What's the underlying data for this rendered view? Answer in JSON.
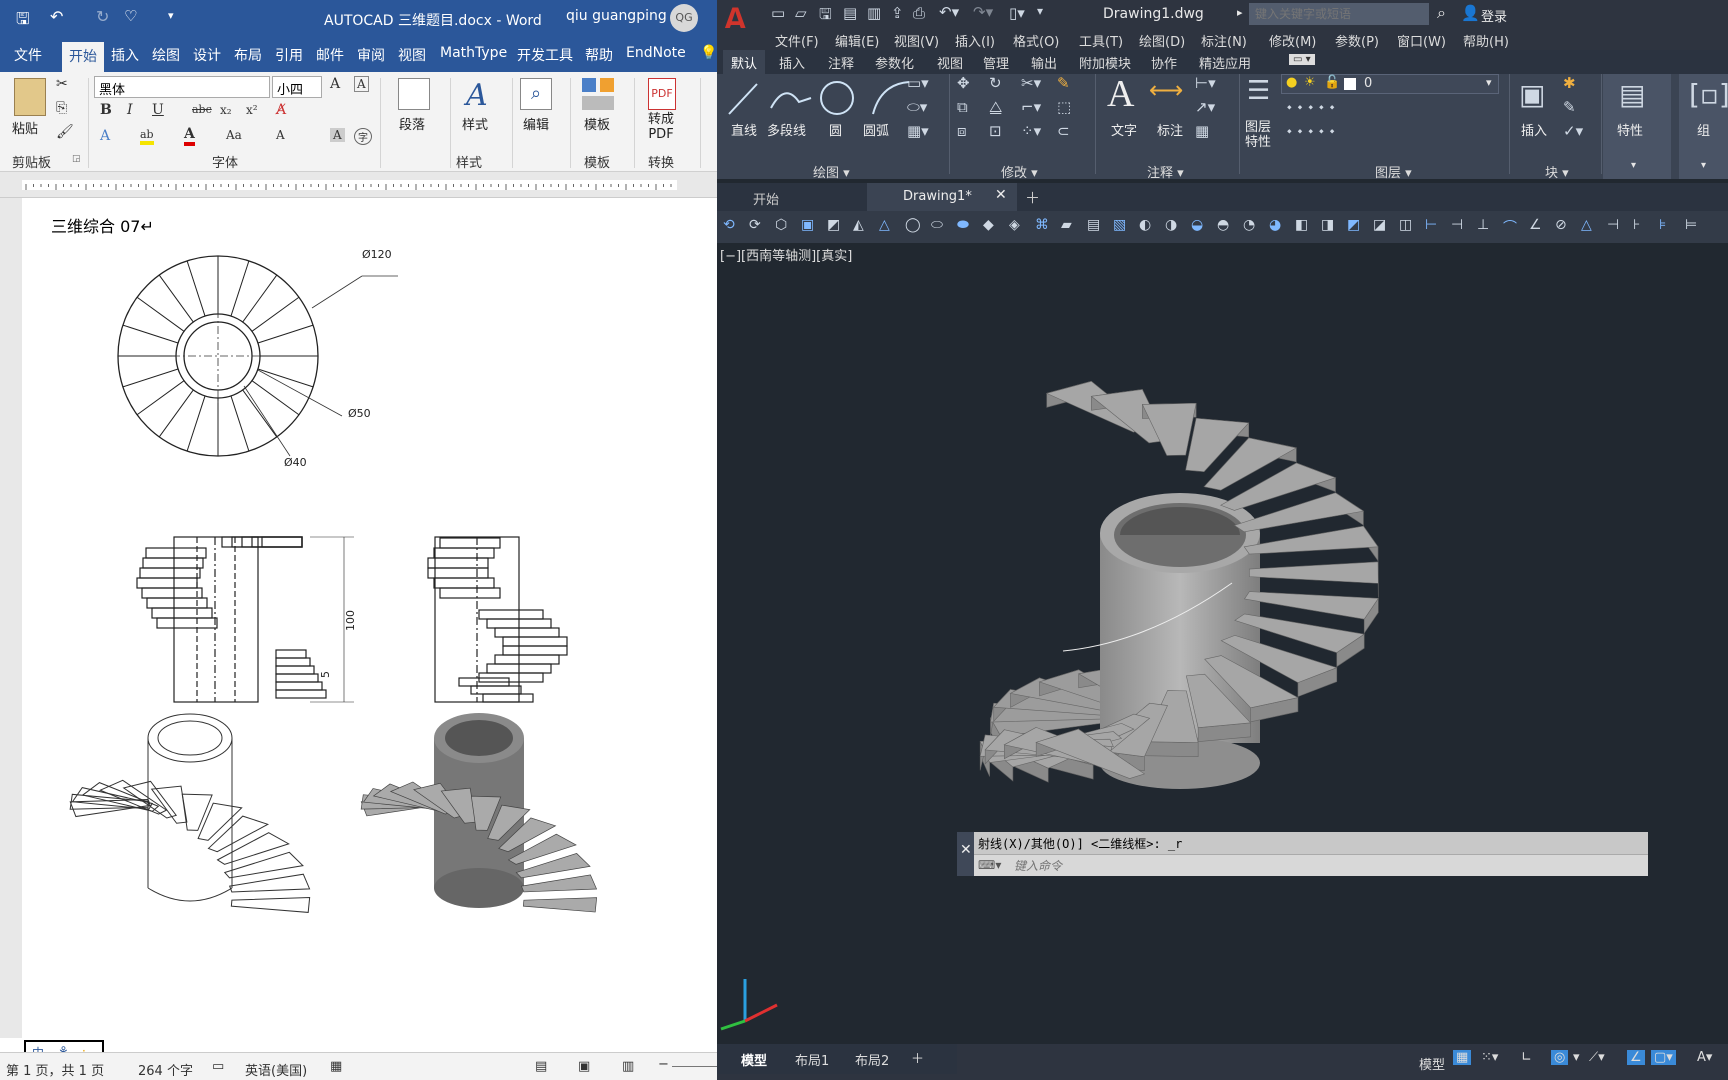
{
  "word": {
    "title": "AUTOCAD 三维题目.docx  -  Word",
    "user": "qiu guangping",
    "user_initials": "QG",
    "tabs": [
      "文件",
      "开始",
      "插入",
      "绘图",
      "设计",
      "布局",
      "引用",
      "邮件",
      "审阅",
      "视图",
      "MathType",
      "开发工具",
      "帮助",
      "EndNote"
    ],
    "font_name": "黑体",
    "font_size": "小四",
    "groups": {
      "clipboard": "剪贴板",
      "font": "字体",
      "style": "样式",
      "template": "模板",
      "convert": "转换"
    },
    "buttons": {
      "paste": "粘贴",
      "paragraph": "段落",
      "styles": "样式",
      "edit": "编辑",
      "template": "模板",
      "to_pdf": "转成\nPDF"
    },
    "doc": {
      "heading": "三维综合 07↵",
      "dims": {
        "d120": "Ø120",
        "d50": "Ø50",
        "d40": "Ø40",
        "h100": "100",
        "h5": "5"
      }
    },
    "status": {
      "page": "第 1 页，共 1 页",
      "words": "264 个字",
      "lang": "英语(美国)"
    },
    "ime": [
      "中",
      "⚘",
      "·"
    ]
  },
  "acad": {
    "title": "Drawing1.dwg",
    "search_placeholder": "键入关键字或短语",
    "login": "登录",
    "menu": [
      "文件(F)",
      "编辑(E)",
      "视图(V)",
      "插入(I)",
      "格式(O)",
      "工具(T)",
      "绘图(D)",
      "标注(N)",
      "修改(M)",
      "参数(P)",
      "窗口(W)",
      "帮助(H)"
    ],
    "ribbon_tabs": [
      "默认",
      "插入",
      "注释",
      "参数化",
      "视图",
      "管理",
      "输出",
      "附加模块",
      "协作",
      "精选应用"
    ],
    "draw": {
      "line": "直线",
      "pline": "多段线",
      "circle": "圆",
      "arc": "圆弧"
    },
    "groups": {
      "draw": "绘图 ▾",
      "modify": "修改 ▾",
      "annot": "注释 ▾",
      "layers": "图层 ▾",
      "block": "块 ▾"
    },
    "annot": {
      "text": "文字",
      "dim": "标注"
    },
    "layer": {
      "props": "图层\n特性",
      "current": "0"
    },
    "insert_lbl": "插入",
    "props_lbl": "特性",
    "group_lbl": "组",
    "doc_tabs": [
      "开始",
      "Drawing1*"
    ],
    "viewport_label": "[−][西南等轴测][真实]",
    "cmd_history": "射线(X)/其他(O)] <二维线框>: _r",
    "cmd_placeholder": "键入命令",
    "layout_tabs": [
      "模型",
      "布局1",
      "布局2"
    ],
    "status_model": "模型"
  }
}
